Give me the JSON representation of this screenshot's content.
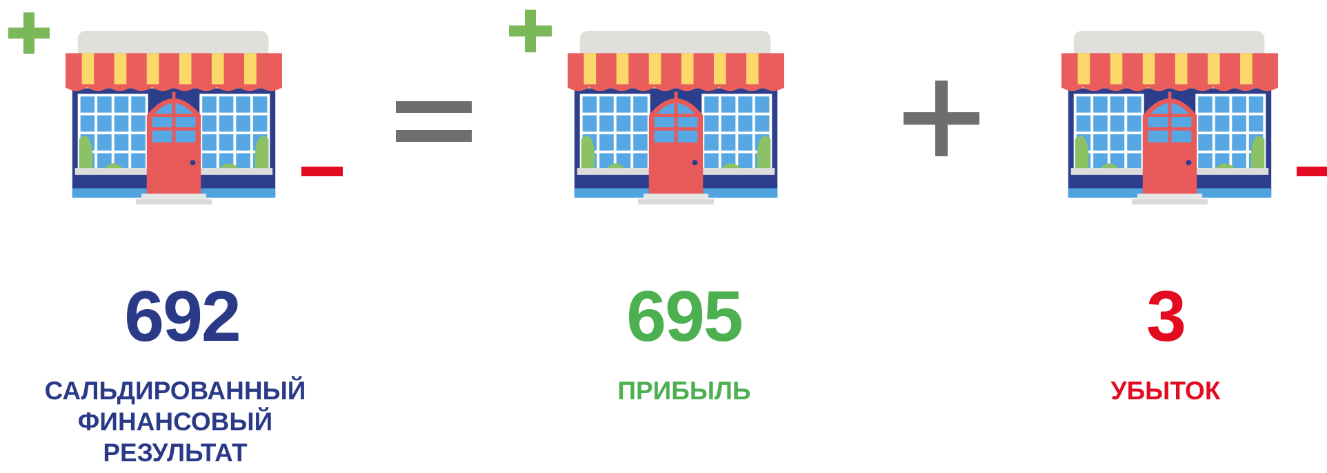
{
  "colors": {
    "balance": "#2b3a87",
    "profit": "#4caf50",
    "loss": "#e30b20",
    "operator": "#6e6e6e",
    "plus_marker": "#7ab85a"
  },
  "icons": [
    "store-icon",
    "plus-icon",
    "minus-icon",
    "equals-icon"
  ],
  "items": [
    {
      "value": "692",
      "label": "САЛЬДИРОВАННЫЙ ФИНАНСОВЫЙ РЕЗУЛЬТАТ",
      "color": "#2b3a87"
    },
    {
      "value": "695",
      "label": "ПРИБЫЛЬ",
      "color": "#4caf50"
    },
    {
      "value": "3",
      "label": "УБЫТОК",
      "color": "#e30b20"
    }
  ]
}
